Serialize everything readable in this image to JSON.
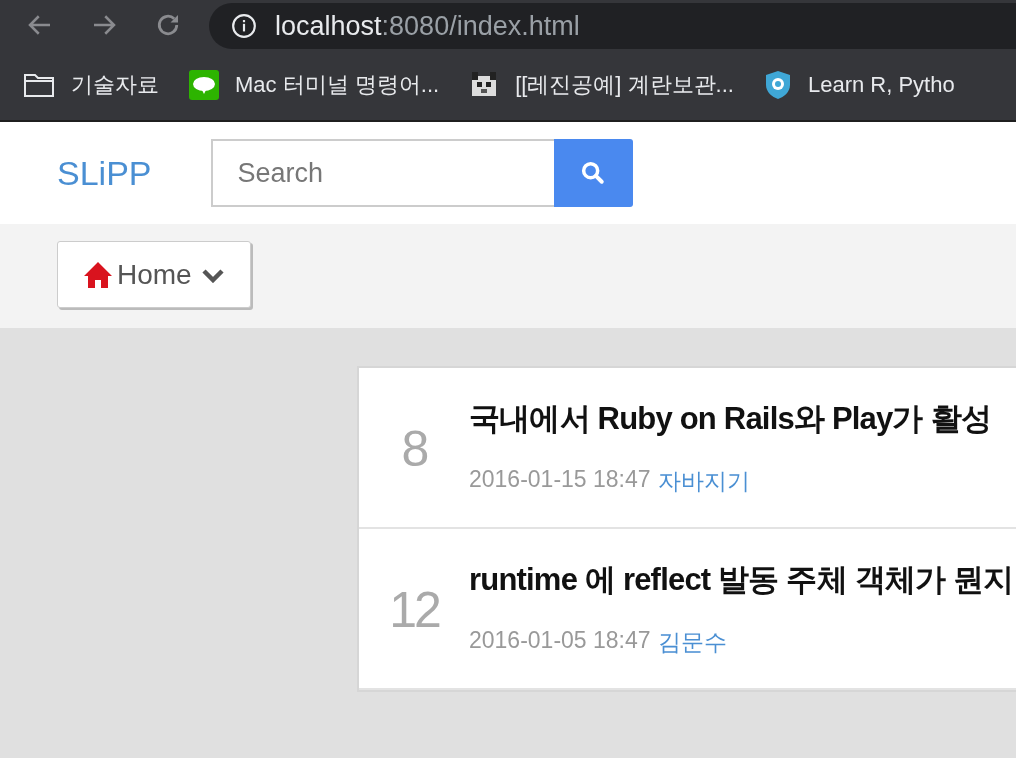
{
  "browser": {
    "url_host": "localhost",
    "url_rest": ":8080/index.html",
    "bookmarks": [
      {
        "kind": "folder",
        "label": "기술자료"
      },
      {
        "kind": "blog",
        "label": "Mac 터미널 명령어..."
      },
      {
        "kind": "pixel",
        "label": "[[레진공예] 계란보관..."
      },
      {
        "kind": "shield",
        "label": "Learn R, Pytho"
      }
    ]
  },
  "header": {
    "logo": "SLiPP",
    "search": {
      "placeholder": "Search"
    }
  },
  "nav": {
    "home_button": "Home"
  },
  "posts": [
    {
      "count": "8",
      "title": "국내에서 Ruby on Rails와 Play가 활성",
      "date": "2016-01-15 18:47",
      "author": "자바지기"
    },
    {
      "count": "12",
      "title": "runtime 에 reflect 발동 주체 객체가 뭔지",
      "date": "2016-01-05 18:47",
      "author": "김문수"
    }
  ]
}
